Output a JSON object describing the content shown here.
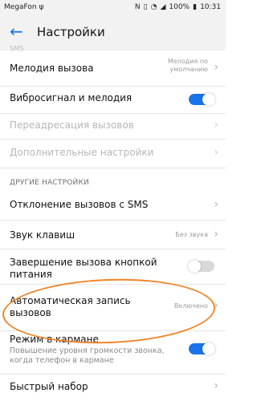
{
  "status_bar": {
    "carrier": "MegaFon",
    "battery": "100%",
    "time": "10:31",
    "icons": [
      "usb-icon",
      "nfc-icon",
      "vibrate-icon",
      "wifi-icon",
      "signal-icon",
      "battery-icon"
    ]
  },
  "appbar": {
    "title": "Настройки",
    "back_icon": "back-arrow-icon"
  },
  "top_partial_label": "SMS",
  "rows": {
    "ringtone": {
      "label": "Мелодия вызова",
      "value_line1": "Мелодия по",
      "value_line2": "умолчанию"
    },
    "vibrate_ringtone": {
      "label": "Вибросигнал и мелодия",
      "toggle": true
    },
    "call_forwarding": {
      "label": "Переадресация вызовов",
      "enabled": false
    },
    "additional_settings": {
      "label": "Дополнительные настройки",
      "enabled": false
    }
  },
  "section_other": "ДРУГИЕ НАСТРОЙКИ",
  "other_rows": {
    "reject_sms": {
      "label": "Отклонение вызовов с SMS"
    },
    "keypad_sound": {
      "label": "Звук клавиш",
      "value": "Без звука"
    },
    "power_end_call": {
      "label_line1": "Завершение вызова кнопкой",
      "label_line2": "питания",
      "toggle": false
    },
    "auto_record": {
      "label_line1": "Автоматическая запись",
      "label_line2": "вызовов",
      "value": "Включено"
    },
    "pocket_mode": {
      "label": "Режим в кармане",
      "sub_line1": "Повышение уровня громкости звонка,",
      "sub_line2": "когда телефон в кармане",
      "toggle": true
    },
    "speed_dial": {
      "label": "Быстрый набор"
    }
  },
  "colors": {
    "accent": "#1a73e8",
    "highlight": "#f0862a",
    "background": "#ffffff",
    "header": "#f2f2f2"
  }
}
